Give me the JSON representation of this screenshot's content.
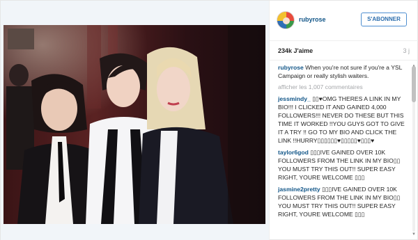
{
  "post": {
    "username": "rubyrose",
    "follow_label": "S'ABONNER",
    "likes": "234k J'aime",
    "time": "3 j",
    "caption": {
      "user": "rubyrose",
      "text": "When you're not sure if you're a YSL Campaign or really stylish waiters."
    },
    "view_all": "afficher les 1,007 commentaires"
  },
  "comments": [
    {
      "user": "jessmindy_",
      "text": "▯▯♥OMG THERES A LINK IN MY BIO!!! I CLICKED IT AND GAINED 4,000 FOLLOWERS!!! NEVER DO THESE BUT THIS TIME IT WORKED !!YOU GUYS GOT TO GIVE IT A TRY !! GO TO MY BIO AND CLICK THE LINK !!HURRY▯▯▯▯▯▯♥▯▯▯▯▯♥▯▯▯♥"
    },
    {
      "user": "taylor6god",
      "text": "▯▯▯IVE GAINED OVER 10K FOLLOWERS FROM THE LINK IN MY BIO▯▯ YOU MUST TRY THIS OUT!! SUPER EASY RIGHT, YOURE WELCOME ▯▯▯"
    },
    {
      "user": "jasmine2pretty",
      "text": "▯▯▯IVE GAINED OVER 10K FOLLOWERS FROM THE LINK IN MY BIO▯▯ YOU MUST TRY THIS OUT!! SUPER EASY RIGHT, YOURE WELCOME ▯▯▯"
    }
  ]
}
